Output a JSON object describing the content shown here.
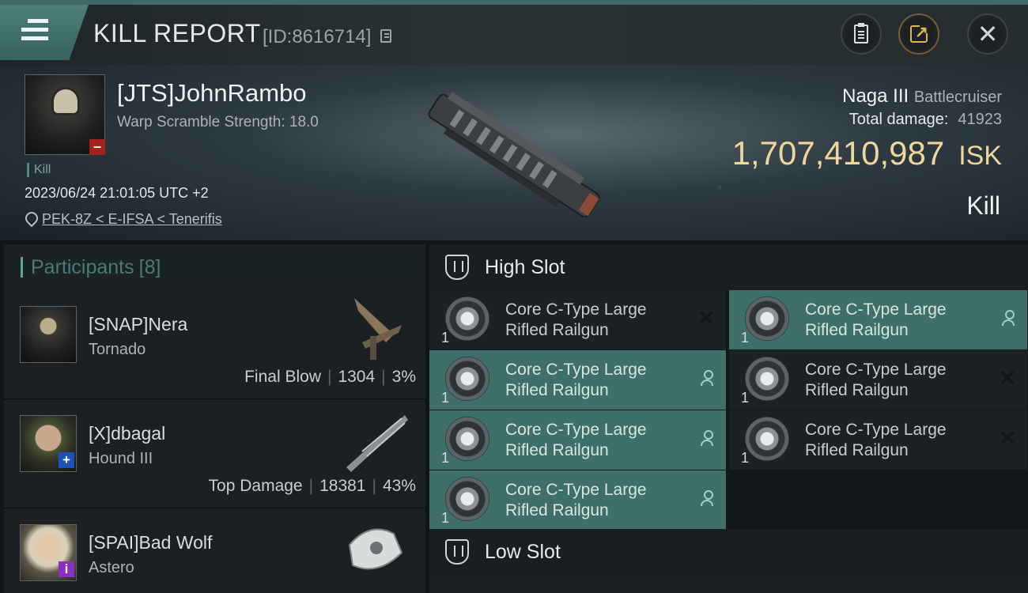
{
  "header": {
    "title": "KILL REPORT",
    "report_id": "[ID:8616714]"
  },
  "victim": {
    "name": "[JTS]JohnRambo",
    "warp_scramble": "Warp Scramble Strength: 18.0",
    "kill_tag": "Kill",
    "timestamp": "2023/06/24 21:01:05 UTC +2",
    "location": "PEK-8Z < E-IFSA < Tenerifis"
  },
  "ship": {
    "name": "Naga III",
    "class": "Battlecruiser",
    "total_damage_label": "Total damage:",
    "total_damage": "41923",
    "isk_value": "1,707,410,987",
    "currency": "ISK",
    "result": "Kill"
  },
  "participants": {
    "label": "Participants",
    "count": "[8]",
    "rows": [
      {
        "name": "[SNAP]Nera",
        "ship": "Tornado",
        "tag": "Final Blow",
        "damage": "1304",
        "percent": "3%",
        "badge": "",
        "badge_color": ""
      },
      {
        "name": "[X]dbagal",
        "ship": "Hound III",
        "tag": "Top Damage",
        "damage": "18381",
        "percent": "43%",
        "badge": "+",
        "badge_color": "#1f4fb8"
      },
      {
        "name": "[SPAI]Bad Wolf",
        "ship": "Astero",
        "tag": "",
        "damage": "",
        "percent": "",
        "badge": "i",
        "badge_color": "#8a2fc0"
      }
    ]
  },
  "high_slot": {
    "label": "High Slot",
    "modules": [
      {
        "line1": "Core C-Type Large",
        "line2": "Rifled Railgun",
        "qty": "1",
        "state": "destroyed"
      },
      {
        "line1": "Core C-Type Large",
        "line2": "Rifled Railgun",
        "qty": "1",
        "state": "dropped"
      },
      {
        "line1": "Core C-Type Large",
        "line2": "Rifled Railgun",
        "qty": "1",
        "state": "dropped"
      },
      {
        "line1": "Core C-Type Large",
        "line2": "Rifled Railgun",
        "qty": "1",
        "state": "destroyed"
      },
      {
        "line1": "Core C-Type Large",
        "line2": "Rifled Railgun",
        "qty": "1",
        "state": "dropped"
      },
      {
        "line1": "Core C-Type Large",
        "line2": "Rifled Railgun",
        "qty": "1",
        "state": "destroyed"
      },
      {
        "line1": "Core C-Type Large",
        "line2": "Rifled Railgun",
        "qty": "1",
        "state": "dropped"
      }
    ]
  },
  "low_slot": {
    "label": "Low Slot"
  },
  "colors": {
    "accent_teal": "#3e6f68",
    "isk_gold": "#efd79a",
    "victim_badge_red": "#a2231c"
  }
}
